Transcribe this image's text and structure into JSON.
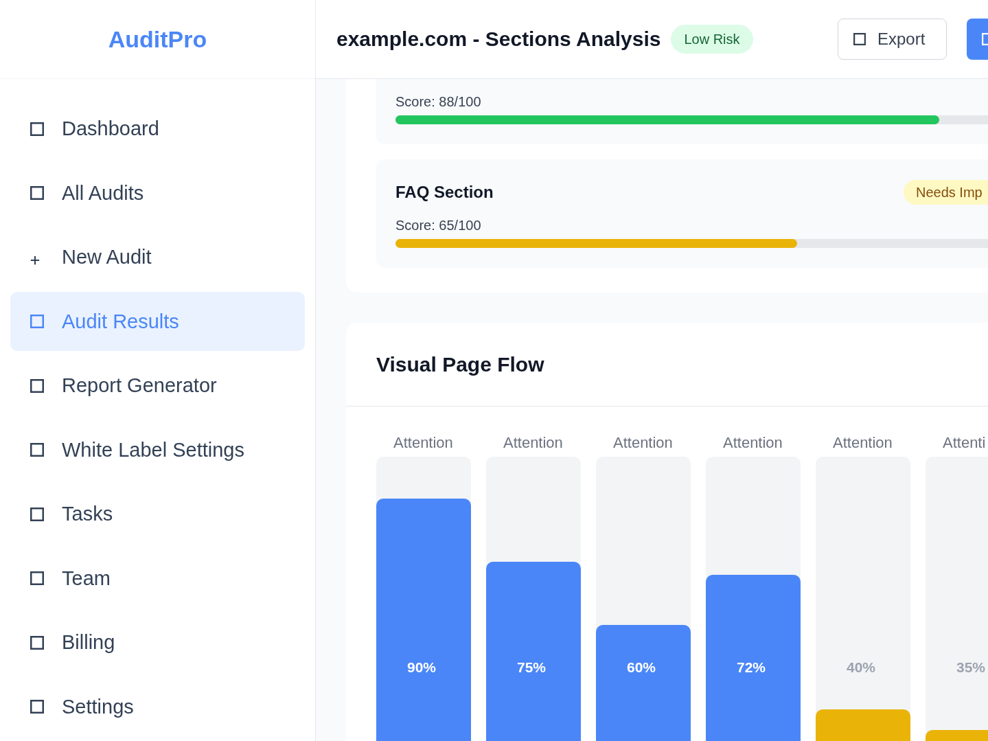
{
  "sidebar": {
    "logo": "AuditPro",
    "items": [
      {
        "label": "Dashboard",
        "kind": "page",
        "selected": false
      },
      {
        "label": "All Audits",
        "kind": "page",
        "selected": false
      },
      {
        "label": "New Audit",
        "kind": "action",
        "selected": false
      },
      {
        "label": "Audit Results",
        "kind": "page",
        "selected": true
      },
      {
        "label": "Report Generator",
        "kind": "page",
        "selected": false
      },
      {
        "label": "White Label Settings",
        "kind": "page",
        "selected": false
      },
      {
        "label": "Tasks",
        "kind": "page",
        "selected": false
      },
      {
        "label": "Team",
        "kind": "page",
        "selected": false
      },
      {
        "label": "Billing",
        "kind": "page",
        "selected": false
      },
      {
        "label": "Settings",
        "kind": "page",
        "selected": false
      }
    ]
  },
  "header": {
    "title": "example.com - Sections Analysis",
    "risk_badge": {
      "text": "Low Risk",
      "kind": "success"
    },
    "buttons": [
      {
        "label": "Export",
        "kind": "secondary"
      },
      {
        "kind": "primary"
      }
    ]
  },
  "sections": [
    {
      "score": "Score: 88/100",
      "level": 0.88,
      "color": "#22c55e"
    },
    {
      "title": "FAQ Section",
      "badge": {
        "text": "Needs Imp",
        "kind": "warning"
      },
      "score": "Score: 65/100",
      "level": 0.65,
      "color": "#eab308"
    }
  ],
  "page_flow": {
    "title": "Visual Page Flow",
    "columns": [
      {
        "label": "Attention",
        "level": 0.9,
        "reading": "90%",
        "color": "#4a86f7"
      },
      {
        "label": "Attention",
        "level": 0.75,
        "reading": "75%",
        "color": "#4a86f7"
      },
      {
        "label": "Attention",
        "level": 0.6,
        "reading": "60%",
        "color": "#4a86f7"
      },
      {
        "label": "Attention",
        "level": 0.72,
        "reading": "72%",
        "color": "#4a86f7"
      },
      {
        "label": "Attention",
        "level": 0.4,
        "reading": "40%",
        "color": "#eab308"
      },
      {
        "label": "Attenti",
        "level": 0.35,
        "reading": "35%",
        "color": "#eab308"
      }
    ]
  }
}
